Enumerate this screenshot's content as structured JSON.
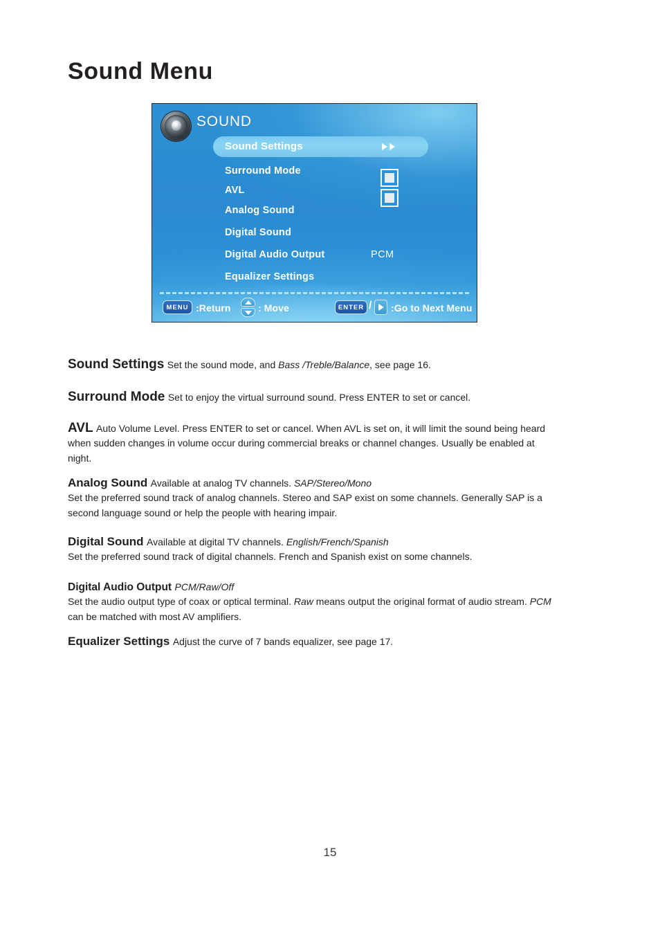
{
  "page": {
    "title": "Sound Menu",
    "number": "15"
  },
  "osd": {
    "speaker_icon": "speaker-icon",
    "title": "SOUND",
    "highlighted_item": {
      "label": "Sound Settings",
      "arrows_icon": "double-right-arrow-icon"
    },
    "items": [
      {
        "label": "Surround Mode",
        "value": "",
        "control": "checkbox"
      },
      {
        "label": "AVL",
        "value": "",
        "control": "checkbox"
      },
      {
        "label": "Analog Sound",
        "value": "",
        "control": "none"
      },
      {
        "label": "Digital Sound",
        "value": "",
        "control": "none"
      },
      {
        "label": "Digital Audio Output",
        "value": "PCM",
        "control": "value"
      },
      {
        "label": "Equalizer Settings",
        "value": "",
        "control": "none"
      }
    ],
    "footer": {
      "menu_key": "MENU",
      "menu_action": ":Return",
      "move_icon": "up-down-arrows-icon",
      "move_action": ": Move",
      "enter_key": "ENTER",
      "slash": "/",
      "right_icon": "right-arrow-icon",
      "enter_action": ":Go to Next Menu"
    },
    "colors": {
      "background_blue": "#2b8ad0",
      "highlight_blue": "#8ad4f2",
      "dash_line": "#b9e4f7",
      "key_button": "#1f54a4"
    }
  },
  "sections": [
    {
      "heading": "Sound Settings",
      "size": "big",
      "lines": [
        {
          "parts": [
            {
              "text": "Set the sound mode, and ",
              "italic": false
            },
            {
              "text": "Bass /Treble/Balance",
              "italic": true
            },
            {
              "text": ", see page 16.",
              "italic": false
            }
          ]
        }
      ]
    },
    {
      "heading": "Surround Mode",
      "size": "big",
      "lines": [
        {
          "parts": [
            {
              "text": "Set to enjoy the virtual surround sound. Press ENTER to set or cancel.",
              "italic": false
            }
          ]
        }
      ]
    },
    {
      "heading": "AVL",
      "size": "big",
      "lines": [
        {
          "parts": [
            {
              "text": "Auto Volume Level. Press ENTER to set  or cancel. When AVL is set on, it will limit the sound being heard when sudden changes in volume occur during commercial breaks or channel changes. Usually be enabled at night.",
              "italic": false
            }
          ]
        }
      ]
    },
    {
      "heading": "Analog Sound",
      "size": "med",
      "lines": [
        {
          "parts": [
            {
              "text": "Available at analog TV channels. ",
              "italic": false
            },
            {
              "text": "SAP/Stereo/Mono",
              "italic": true
            }
          ]
        },
        {
          "parts": [
            {
              "text": "Set the preferred sound track of analog channels. Stereo and SAP exist on some channels. Generally SAP is a second language sound or help the people with hearing impair.",
              "italic": false
            }
          ]
        }
      ]
    },
    {
      "heading": "Digital Sound",
      "size": "med",
      "lines": [
        {
          "parts": [
            {
              "text": "Available at digital TV channels. ",
              "italic": false
            },
            {
              "text": "English/French/Spanish",
              "italic": true
            }
          ]
        },
        {
          "parts": [
            {
              "text": "Set the preferred sound track of digital channels. French and Spanish exist on some channels.",
              "italic": false
            }
          ]
        }
      ]
    },
    {
      "heading": "Digital Audio Output",
      "size": "sml",
      "lines": [
        {
          "parts": [
            {
              "text": "PCM/Raw/Off",
              "italic": true
            }
          ]
        },
        {
          "parts": [
            {
              "text": "Set the audio output type of coax or optical terminal. ",
              "italic": false
            },
            {
              "text": "Raw",
              "italic": true
            },
            {
              "text": " means output the original format of audio stream. ",
              "italic": false
            },
            {
              "text": "PCM",
              "italic": true
            },
            {
              "text": " can be matched with most AV amplifiers.",
              "italic": false
            }
          ]
        }
      ]
    },
    {
      "heading": "Equalizer Settings",
      "size": "med",
      "lines": [
        {
          "parts": [
            {
              "text": "Adjust the curve of 7 bands equalizer, see page 17.",
              "italic": false
            }
          ]
        }
      ]
    }
  ]
}
